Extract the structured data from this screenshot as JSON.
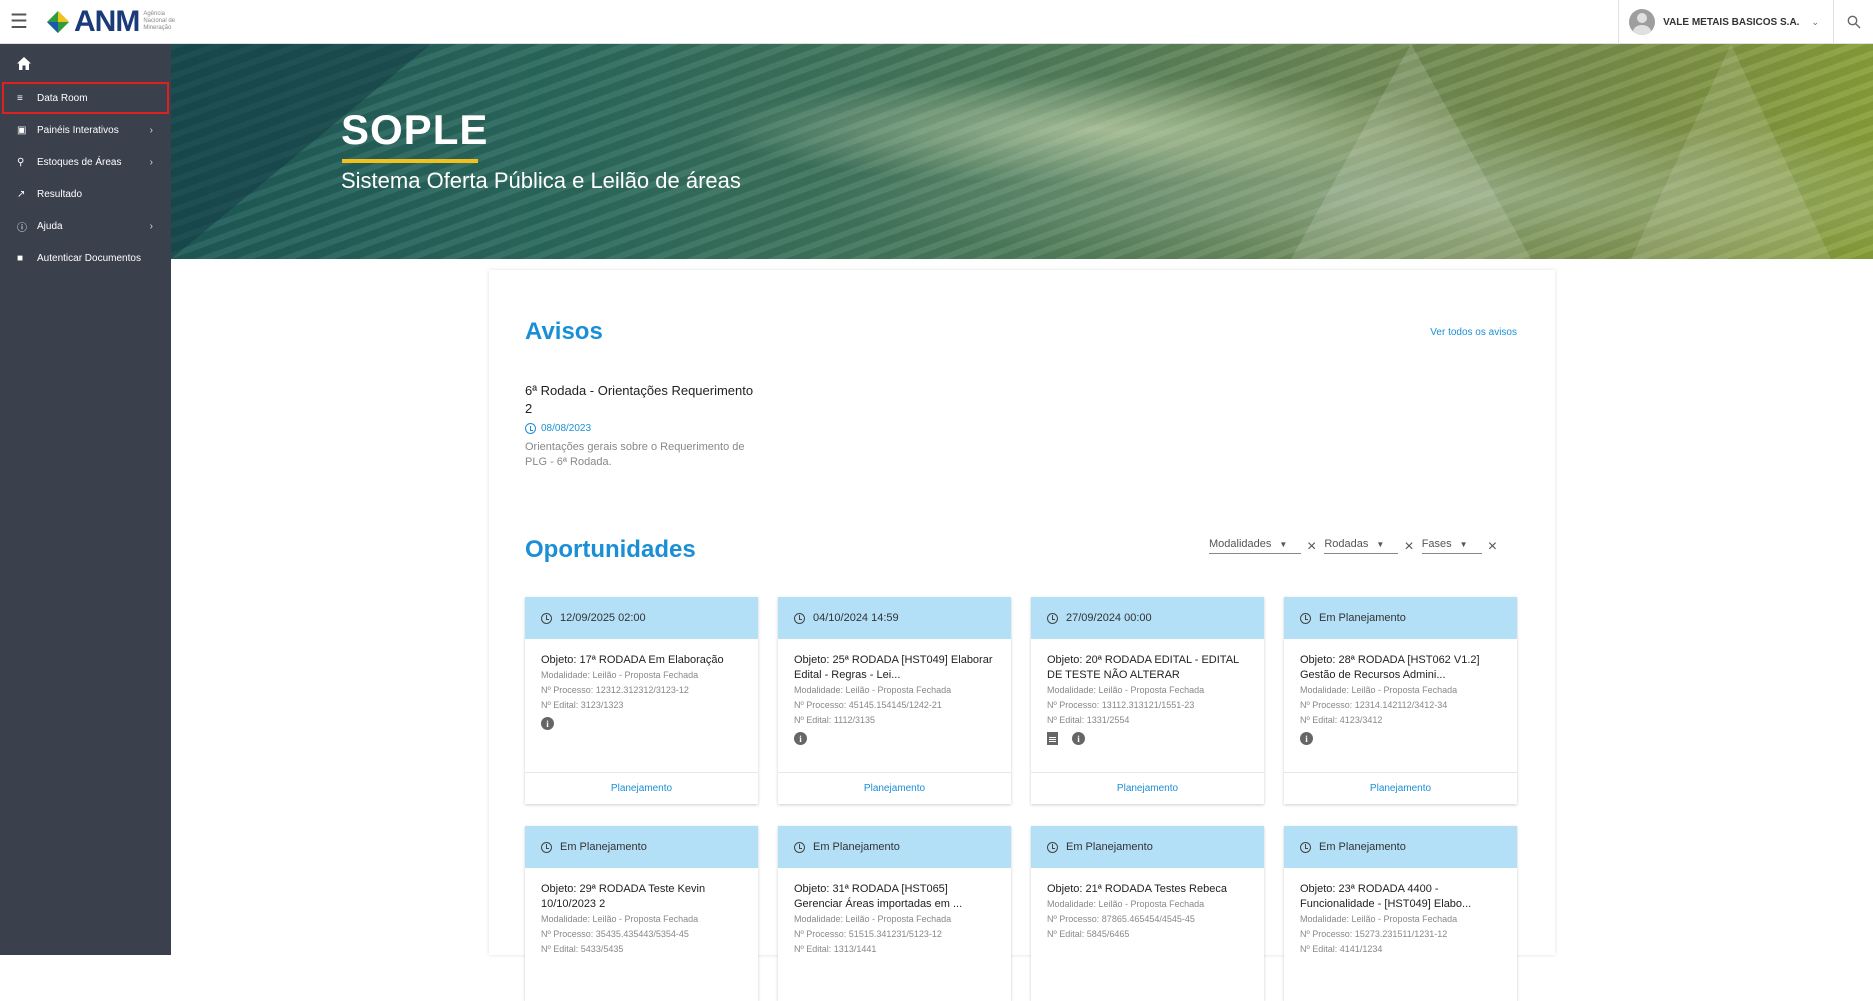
{
  "app": {
    "logo_text": "ANM",
    "logo_sub": "Agência Nacional de Mineração"
  },
  "user": {
    "name": "VALE METAIS BASICOS S.A."
  },
  "sidebar": {
    "items": [
      {
        "label": "Data Room",
        "icon": "list-icon"
      },
      {
        "label": "Painéis Interativos",
        "icon": "dashboard-icon"
      },
      {
        "label": "Estoques de Áreas",
        "icon": "location-pin-icon"
      },
      {
        "label": "Resultado",
        "icon": "trending-icon"
      },
      {
        "label": "Ajuda",
        "icon": "help-icon"
      },
      {
        "label": "Autenticar Documentos",
        "icon": "book-icon"
      }
    ]
  },
  "banner": {
    "title": "SOPLE",
    "subtitle": "Sistema Oferta Pública e Leilão de áreas"
  },
  "avisos": {
    "title": "Avisos",
    "see_all": "Ver todos os avisos",
    "item": {
      "title": "6ª Rodada - Orientações Requerimento 2",
      "date": "08/08/2023",
      "desc": "Orientações gerais sobre o Requerimento de PLG - 6ª Rodada."
    }
  },
  "oportunidades": {
    "title": "Oportunidades",
    "filters": {
      "modalidades": "Modalidades",
      "rodadas": "Rodadas",
      "fases": "Fases"
    },
    "cards": [
      {
        "head": "12/09/2025 02:00",
        "obj": "Objeto: 17ª RODADA Em Elaboração",
        "modalidade": "Modalidade: Leilão - Proposta Fechada",
        "processo": "Nº Processo: 12312.312312/3123-12",
        "edital": "Nº Edital: 3123/1323",
        "foot": "Planejamento"
      },
      {
        "head": "04/10/2024 14:59",
        "obj": "Objeto: 25ª RODADA [HST049] Elaborar Edital - Regras - Lei...",
        "modalidade": "Modalidade: Leilão - Proposta Fechada",
        "processo": "Nº Processo: 45145.154145/1242-21",
        "edital": "Nº Edital: 1112/3135",
        "foot": "Planejamento"
      },
      {
        "head": "27/09/2024 00:00",
        "obj": "Objeto: 20ª RODADA EDITAL - EDITAL DE TESTE NÃO ALTERAR",
        "modalidade": "Modalidade: Leilão - Proposta Fechada",
        "processo": "Nº Processo: 13112.313121/1551-23",
        "edital": "Nº Edital: 1331/2554",
        "foot": "Planejamento"
      },
      {
        "head": "Em Planejamento",
        "obj": "Objeto: 28ª RODADA [HST062 V1.2] Gestão de Recursos Admini...",
        "modalidade": "Modalidade: Leilão - Proposta Fechada",
        "processo": "Nº Processo: 12314.142112/3412-34",
        "edital": "Nº Edital: 4123/3412",
        "foot": "Planejamento"
      },
      {
        "head": "Em Planejamento",
        "obj": "Objeto: 29ª RODADA Teste Kevin 10/10/2023 2",
        "modalidade": "Modalidade: Leilão - Proposta Fechada",
        "processo": "Nº Processo: 35435.435443/5354-45",
        "edital": "Nº Edital: 5433/5435"
      },
      {
        "head": "Em Planejamento",
        "obj": "Objeto: 31ª RODADA [HST065] Gerenciar Áreas importadas em ...",
        "modalidade": "Modalidade: Leilão - Proposta Fechada",
        "processo": "Nº Processo: 51515.341231/5123-12",
        "edital": "Nº Edital: 1313/1441"
      },
      {
        "head": "Em Planejamento",
        "obj": "Objeto: 21ª RODADA Testes Rebeca",
        "modalidade": "Modalidade: Leilão - Proposta Fechada",
        "processo": "Nº Processo: 87865.465454/4545-45",
        "edital": "Nº Edital: 5845/6465"
      },
      {
        "head": "Em Planejamento",
        "obj": "Objeto: 23ª RODADA 4400 - Funcionalidade - [HST049] Elabo...",
        "modalidade": "Modalidade: Leilão - Proposta Fechada",
        "processo": "Nº Processo: 15273.231511/1231-12",
        "edital": "Nº Edital: 4141/1234"
      }
    ]
  }
}
